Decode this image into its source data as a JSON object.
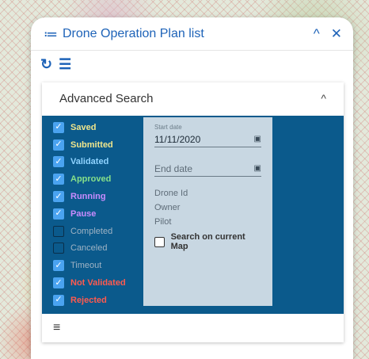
{
  "panel": {
    "title": "Drone Operation Plan list",
    "list_icon": "≔",
    "collapse_icon": "^",
    "close_icon": "✕"
  },
  "toolbar": {
    "refresh_icon": "↻",
    "list_icon": "☰"
  },
  "advanced_search": {
    "title": "Advanced Search",
    "collapse_icon": "^",
    "statuses": [
      {
        "label": "Saved",
        "checked": true,
        "color": "#f0e68c"
      },
      {
        "label": "Submitted",
        "checked": true,
        "color": "#f0e68c"
      },
      {
        "label": "Validated",
        "checked": true,
        "color": "#8fd3ff"
      },
      {
        "label": "Approved",
        "checked": true,
        "color": "#86e08a"
      },
      {
        "label": "Running",
        "checked": true,
        "color": "#c98bff"
      },
      {
        "label": "Pause",
        "checked": true,
        "color": "#c98bff"
      },
      {
        "label": "Completed",
        "checked": false,
        "color": "#9fb3c4"
      },
      {
        "label": "Canceled",
        "checked": false,
        "color": "#9fb3c4"
      },
      {
        "label": "Timeout",
        "checked": true,
        "color": "#9fb3c4"
      },
      {
        "label": "Not Validated",
        "checked": true,
        "color": "#ff5a4f"
      },
      {
        "label": "Rejected",
        "checked": true,
        "color": "#ff5a4f"
      }
    ],
    "start_date_label": "Start date",
    "start_date_value": "11/11/2020",
    "end_date_placeholder": "End date",
    "drone_id_label": "Drone Id",
    "owner_label": "Owner",
    "pilot_label": "Pilot",
    "search_map_label": "Search on current Map",
    "calendar_icon": "▣",
    "filter_icon": "≡"
  }
}
